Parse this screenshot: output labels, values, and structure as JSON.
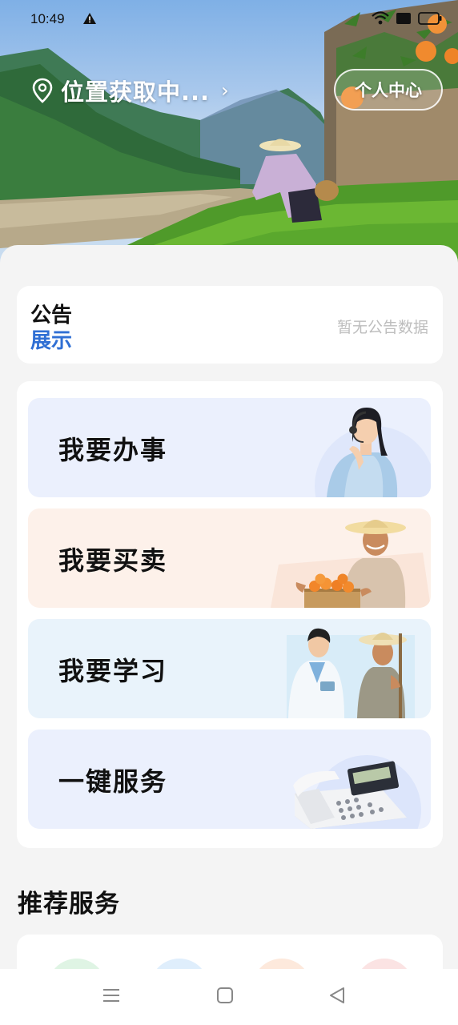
{
  "status_bar": {
    "time": "10:49"
  },
  "header": {
    "location_text": "位置获取中...",
    "profile_button": "个人中心"
  },
  "notice": {
    "title_line1": "公告",
    "title_line2": "展示",
    "empty_text": "暂无公告数据"
  },
  "services": [
    {
      "label": "我要办事"
    },
    {
      "label": "我要买卖"
    },
    {
      "label": "我要学习"
    },
    {
      "label": "一键服务"
    }
  ],
  "recommended": {
    "title": "推荐服务"
  },
  "colors": {
    "accent_blue": "#2f6fd4",
    "card_blue": "#ebf0fd",
    "card_peach": "#fdf1ea",
    "card_sky": "#e9f3fb"
  },
  "icons": [
    "location-pin-icon",
    "chevron-right-icon",
    "warning-icon",
    "wifi-icon",
    "battery-icon",
    "menu-icon",
    "home-square-icon",
    "back-triangle-icon"
  ]
}
